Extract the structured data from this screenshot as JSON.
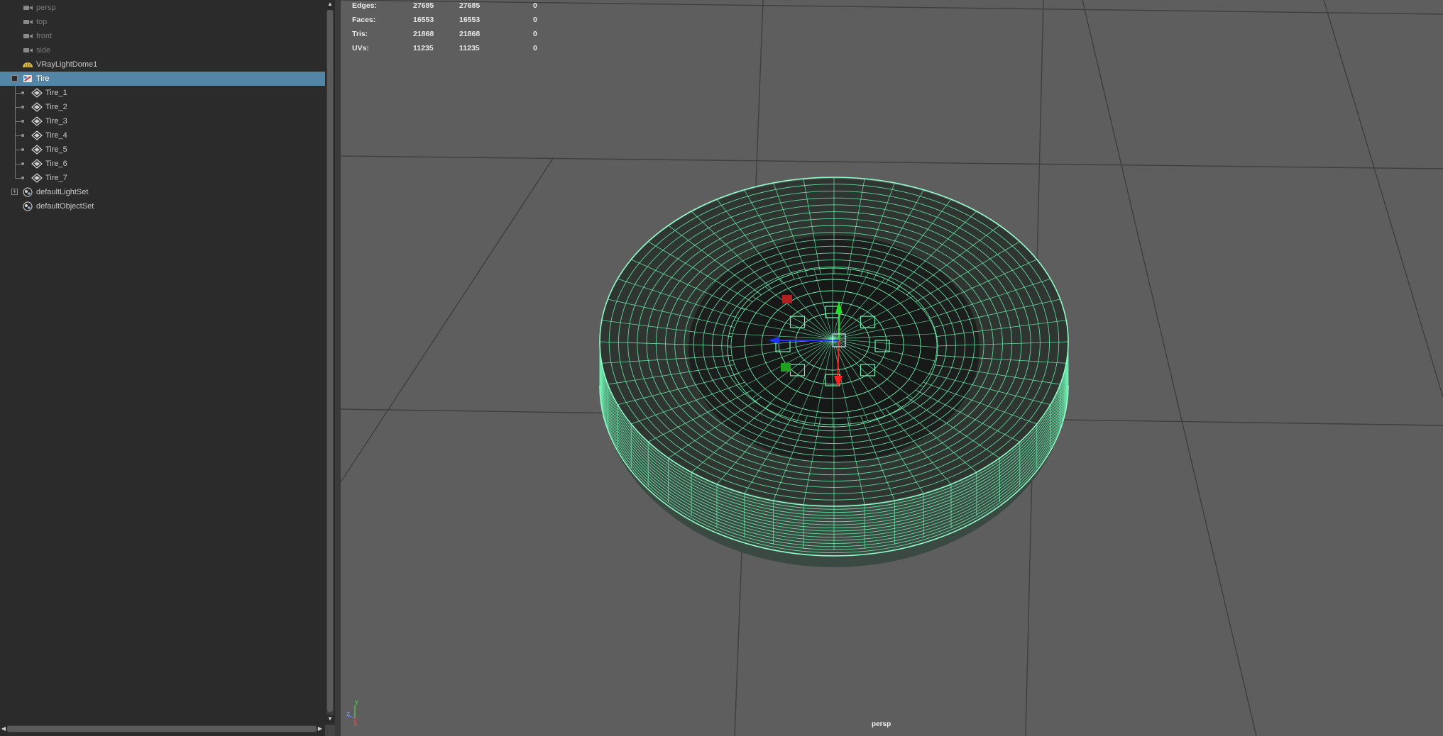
{
  "outliner": {
    "items": [
      {
        "label": "persp",
        "icon": "camera-icon",
        "dim": true
      },
      {
        "label": "top",
        "icon": "camera-icon",
        "dim": true
      },
      {
        "label": "front",
        "icon": "camera-icon",
        "dim": true
      },
      {
        "label": "side",
        "icon": "camera-icon",
        "dim": true
      },
      {
        "label": "VRayLightDome1",
        "icon": "dome-light-icon"
      },
      {
        "label": "Tire",
        "icon": "group-icon",
        "selected": true,
        "expand": "-"
      },
      {
        "label": "Tire_1",
        "icon": "mesh-icon",
        "child": true
      },
      {
        "label": "Tire_2",
        "icon": "mesh-icon",
        "child": true
      },
      {
        "label": "Tire_3",
        "icon": "mesh-icon",
        "child": true
      },
      {
        "label": "Tire_4",
        "icon": "mesh-icon",
        "child": true
      },
      {
        "label": "Tire_5",
        "icon": "mesh-icon",
        "child": true
      },
      {
        "label": "Tire_6",
        "icon": "mesh-icon",
        "child": true
      },
      {
        "label": "Tire_7",
        "icon": "mesh-icon",
        "child": true
      },
      {
        "label": "defaultLightSet",
        "icon": "set-icon",
        "expand": "+"
      },
      {
        "label": "defaultObjectSet",
        "icon": "set-icon"
      }
    ]
  },
  "hud": {
    "rows": [
      {
        "label": "Edges:",
        "a": "27685",
        "b": "27685",
        "c": "0"
      },
      {
        "label": "Faces:",
        "a": "16553",
        "b": "16553",
        "c": "0"
      },
      {
        "label": "Tris:",
        "a": "21868",
        "b": "21868",
        "c": "0"
      },
      {
        "label": "UVs:",
        "a": "11235",
        "b": "11235",
        "c": "0"
      }
    ]
  },
  "viewport": {
    "camera": "persp",
    "axis_labels": {
      "y": "Y",
      "x": "X",
      "z": "Z"
    },
    "wire_color": "#6ff0b0",
    "background_color": "#5e5e5e",
    "selection_color": "#5285a6"
  }
}
